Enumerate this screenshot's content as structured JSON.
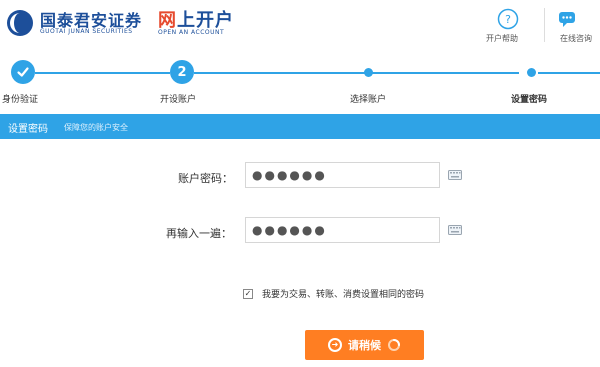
{
  "header": {
    "brand_cn": "国泰君安证券",
    "brand_en": "GUOTAI JUNAN SECURITIES",
    "open_cn_part1": "网",
    "open_cn_part2": "上开户",
    "open_en": "OPEN AN ACCOUNT",
    "help_label": "开户帮助",
    "consult_label": "在线咨询"
  },
  "steps": [
    {
      "label": "身份验证",
      "state": "done"
    },
    {
      "label": "开设账户",
      "state": "number",
      "number": "2"
    },
    {
      "label": "选择账户",
      "state": "dot"
    },
    {
      "label": "设置密码",
      "state": "current"
    }
  ],
  "section": {
    "title": "设置密码",
    "subtitle": "保障您的账户安全"
  },
  "form": {
    "password_label": "账户密码：",
    "password_value": "●●●●●●",
    "confirm_label": "再输入一遍：",
    "confirm_value": "●●●●●●",
    "checkbox_text": "我要为交易、转账、消费设置相同的密码",
    "checkbox_checked": true,
    "submit_label": "请稍候"
  },
  "colors": {
    "accent": "#2fa3e6",
    "brand": "#1d4f9a",
    "button": "#ff7e22"
  }
}
